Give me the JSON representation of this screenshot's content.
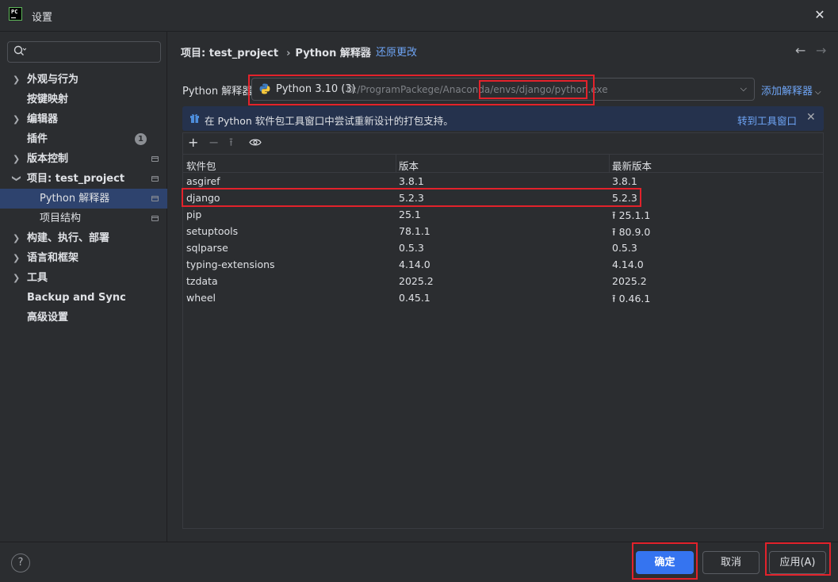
{
  "window": {
    "title": "设置",
    "logo_text": "PC"
  },
  "sidebar": {
    "search_placeholder": "",
    "items": [
      {
        "label": "外观与行为",
        "expandable": true
      },
      {
        "label": "按键映射",
        "expandable": false
      },
      {
        "label": "编辑器",
        "expandable": true
      },
      {
        "label": "插件",
        "expandable": false,
        "badge": "1"
      },
      {
        "label": "版本控制",
        "expandable": true
      },
      {
        "label": "项目: test_project",
        "expandable": true,
        "expanded": true
      },
      {
        "label": "Python 解释器",
        "child": true,
        "selected": true
      },
      {
        "label": "项目结构",
        "child": true
      },
      {
        "label": "构建、执行、部署",
        "expandable": true
      },
      {
        "label": "语言和框架",
        "expandable": true
      },
      {
        "label": "工具",
        "expandable": true
      },
      {
        "label": "Backup and Sync",
        "expandable": false
      },
      {
        "label": "高级设置",
        "expandable": false
      }
    ]
  },
  "breadcrumb": {
    "project": "项目: test_project",
    "page": "Python 解释器",
    "reset": "还原更改"
  },
  "interpreter": {
    "label": "Python 解释器:",
    "name": "Python 3.10 (3)",
    "path": "D:/ProgramPackege/Anaconda/envs/django/python.exe",
    "add_label": "添加解释器"
  },
  "banner": {
    "text": "在 Python 软件包工具窗口中尝试重新设计的打包支持。",
    "link": "转到工具窗口"
  },
  "packages": {
    "headers": [
      "软件包",
      "版本",
      "最新版本"
    ],
    "rows": [
      {
        "name": "asgiref",
        "version": "3.8.1",
        "latest": "3.8.1",
        "upgrade": false
      },
      {
        "name": "django",
        "version": "5.2.3",
        "latest": "5.2.3",
        "upgrade": false
      },
      {
        "name": "pip",
        "version": "25.1",
        "latest": "25.1.1",
        "upgrade": true
      },
      {
        "name": "setuptools",
        "version": "78.1.1",
        "latest": "80.9.0",
        "upgrade": true
      },
      {
        "name": "sqlparse",
        "version": "0.5.3",
        "latest": "0.5.3",
        "upgrade": false
      },
      {
        "name": "typing-extensions",
        "version": "4.14.0",
        "latest": "4.14.0",
        "upgrade": false
      },
      {
        "name": "tzdata",
        "version": "2025.2",
        "latest": "2025.2",
        "upgrade": false
      },
      {
        "name": "wheel",
        "version": "0.45.1",
        "latest": "0.46.1",
        "upgrade": true
      }
    ]
  },
  "footer": {
    "ok": "确定",
    "cancel": "取消",
    "apply": "应用(A)",
    "help": "?"
  },
  "colors": {
    "accent": "#3574f0",
    "link": "#6ea4f4",
    "selection": "#2e436e",
    "annotation": "#e3222b"
  },
  "icons": [
    "search-icon",
    "chevron-right-icon",
    "chevron-down-icon",
    "project-scope-icon",
    "python-icon",
    "gift-icon",
    "close-icon",
    "add-icon",
    "remove-icon",
    "upgrade-icon",
    "eye-icon",
    "arrow-left-icon",
    "arrow-right-icon",
    "help-icon"
  ]
}
